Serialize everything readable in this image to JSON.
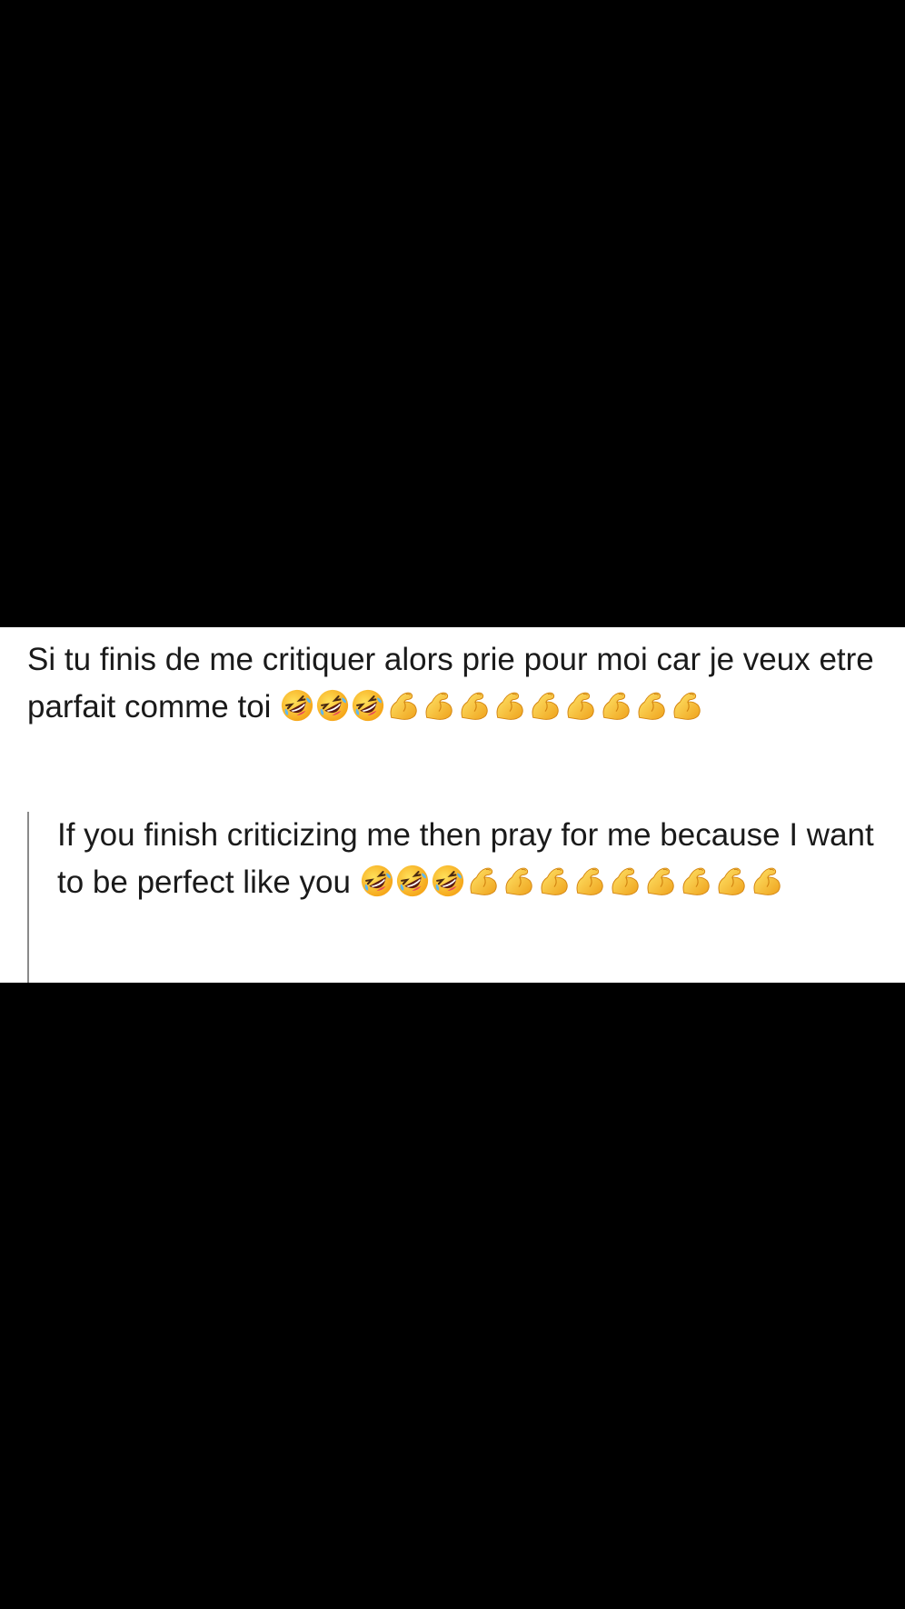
{
  "original": {
    "text": "Si tu finis de me critiquer alors prie pour moi car je veux etre parfait comme toi",
    "laughing_emoji_count": 3,
    "flex_emoji_count": 9
  },
  "translation": {
    "text": "If you finish criticizing me then pray for me because I want to be perfect like you",
    "laughing_emoji_count": 3,
    "flex_emoji_count": 9
  },
  "icons": {
    "laughing": "rolling-on-floor-laughing-emoji",
    "flex": "flexed-biceps-emoji"
  },
  "colors": {
    "background": "#000000",
    "card": "#ffffff",
    "text": "#1a1a1a",
    "quote_bar": "#8a8a8a"
  }
}
